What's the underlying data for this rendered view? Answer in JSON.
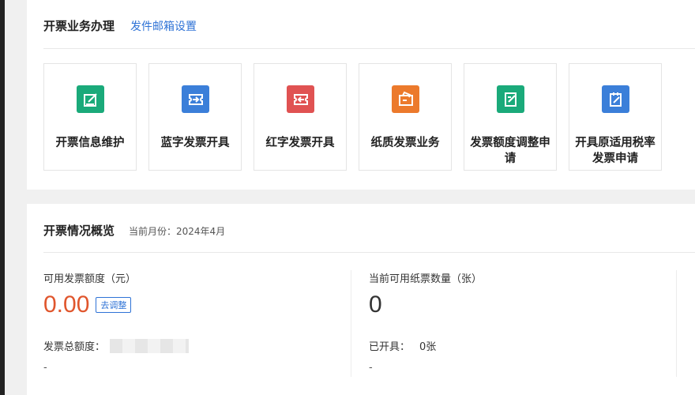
{
  "business": {
    "title": "开票业务办理",
    "email_link": "发件邮箱设置",
    "tiles": [
      {
        "label": "开票信息维护",
        "icon": "edit-box-icon",
        "color": "#1aaa7a"
      },
      {
        "label": "蓝字发票开具",
        "icon": "blue-invoice-icon",
        "color": "#3b7fd9"
      },
      {
        "label": "红字发票开具",
        "icon": "red-invoice-icon",
        "color": "#e05252"
      },
      {
        "label": "纸质发票业务",
        "icon": "paper-invoice-icon",
        "color": "#ec7a2c"
      },
      {
        "label": "发票额度调整申请",
        "icon": "quota-adjust-icon",
        "color": "#1aaa7a"
      },
      {
        "label": "开具原适用税率发票申请",
        "icon": "tax-rate-apply-icon",
        "color": "#3b7fd9"
      }
    ]
  },
  "overview": {
    "title": "开票情况概览",
    "current_month": "当前月份：2024年4月",
    "available_quota": {
      "label": "可用发票额度（元）",
      "value": "0.00",
      "adjust_button": "去调整",
      "total_label": "发票总额度：",
      "dash": "-"
    },
    "paper_count": {
      "label": "当前可用纸票数量（张）",
      "value": "0",
      "issued_label": "已开具：",
      "issued_value": "0张",
      "dash": "-"
    }
  }
}
